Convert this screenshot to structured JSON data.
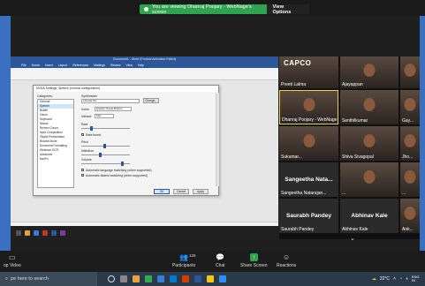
{
  "banner": {
    "text": "You are viewing Dhanraj Poojary - WebNage's screen",
    "options": "View Options"
  },
  "shared_screen": {
    "window_title": "Document1 - Word (Product Activation Failed)",
    "ribbon_tabs": [
      "File",
      "Home",
      "Insert",
      "Layout",
      "References",
      "Mailings",
      "Review",
      "View",
      "Help"
    ],
    "dialog": {
      "title": "NVDA Settings: Speech (normal configuration)",
      "categories_label": "Categories:",
      "categories": [
        "General",
        "Speech",
        "Braille",
        "Vision",
        "Keyboard",
        "Mouse",
        "Review Cursor",
        "Input Composition",
        "Object Presentation",
        "Browse Mode",
        "Document Formatting",
        "Windows OCR",
        "Advanced",
        "NaxPo"
      ],
      "selected_category": 1,
      "synth_label": "Synthesizer",
      "synth_value": "eSpeak NG",
      "change_button": "Change...",
      "voice_label": "Voice:",
      "voice_value": "English (Great Britain)",
      "variant_label": "Variant:",
      "variant_value": "Max",
      "rate_label": "Rate",
      "rate_boost_label": "Rate boost",
      "pitch_label": "Pitch",
      "inflection_label": "Inflection",
      "volume_label": "Volume",
      "check1": "Automatic language switching (when supported)",
      "check2": "Automatic dialect switching (when supported)",
      "ok": "OK",
      "cancel": "Cancel",
      "apply": "Apply"
    }
  },
  "participants_grid": [
    {
      "name": "Preeti Lalma",
      "logo": "CAPCO"
    },
    {
      "name": "Ajayappan"
    },
    {
      "name": ""
    },
    {
      "name": "Dhanraj Poojary - WebNage",
      "active": true
    },
    {
      "name": "Senthilkumar"
    },
    {
      "name": "Gay..."
    },
    {
      "name": "Sukumar..."
    },
    {
      "name": "Shiva Sivagopal"
    },
    {
      "name": "Jho..."
    },
    {
      "name": "Sangeetha Natarajan...",
      "big": "Sangeetha Nata..."
    },
    {
      "name": "..."
    },
    {
      "name": "..."
    },
    {
      "name": "Saurabh Pandey",
      "big": "Saurabh Pandey"
    },
    {
      "name": "Abhinav Kale",
      "big": "Abhinav Kale"
    },
    {
      "name": "Ank..."
    }
  ],
  "controls": {
    "stop_video": "op Video",
    "participants": "Participants",
    "participants_count": "125",
    "chat": "Chat",
    "share_screen": "Share Screen",
    "reactions": "Reactions"
  },
  "taskbar": {
    "search_placeholder": "pe here to search",
    "weather": "22°C",
    "lang": "ENG IN"
  }
}
